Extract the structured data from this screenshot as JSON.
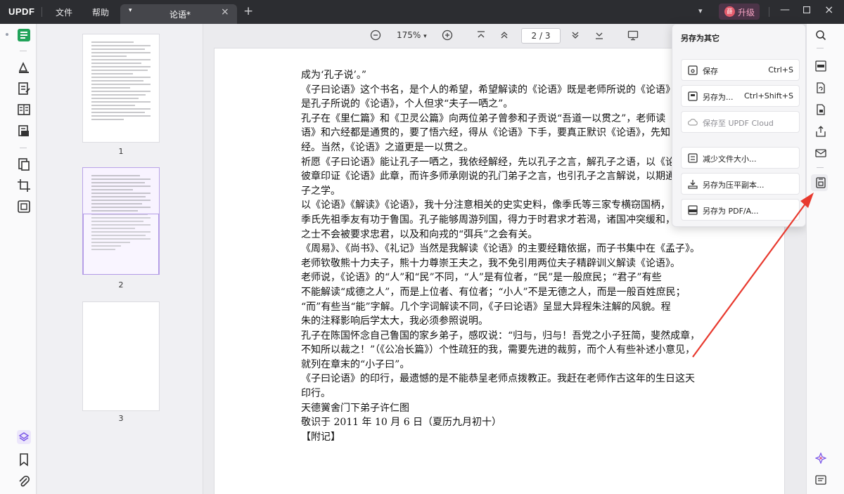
{
  "titlebar": {
    "logo": "UPDF",
    "menu": [
      "文件",
      "帮助"
    ],
    "tab_title": "论语*",
    "upgrade_avatar": "薛",
    "upgrade_label": "升级"
  },
  "toolbar": {
    "zoom": "175%",
    "page_current": "2",
    "page_total": "3"
  },
  "thumbnails": [
    {
      "number": "1"
    },
    {
      "number": "2"
    },
    {
      "number": "3"
    }
  ],
  "document": {
    "lines": [
      "成为‘孔子说’。”",
      "《子曰论语》这个书名，是个人的希望，希望解读的《论语》既是老师所说的《论语》",
      "是孔子所说的《论语》，个人但求“夫子一哂之”。",
      "孔子在《里仁篇》和《卫灵公篇》向两位弟子曾参和子贡说“吾道一以贯之”，老师读",
      "语》和六经都是通贯的，要了悟六经，得从《论语》下手，要真正默识《论语》，先知",
      "经。当然，《论语》之道更是一以贯之。",
      "祈愿《子曰论语》能让孔子一哂之，我依经解经，先以孔子之言，解孔子之语，以《论",
      "彼章印证《论语》此章，而许多师承刚说的孔门弟子之言，也引孔子之言解说，以期通",
      "子之学。",
      "以《论语》《解读》《论语》，我十分注意相关的史实史料，像季氏等三家专横窃国柄，",
      "季氏先祖季友有功于鲁国。孔子能够周游列国，得力于时君求才若渴，诸国冲突缓和，",
      "之士不会被要求忠君，以及和向戎的“弭兵”之会有关。",
      "《周易》、《尚书》、《礼记》当然是我解读《论语》的主要经籍依据，而子书集中在《孟子》。",
      "老师钦敬熊十力夫子，熊十力尊崇王夫之，我不免引用两位夫子精辟训义解读《论语》。",
      "老师说，《论语》的“人”和“民”不同，“人”是有位者，“民”是一般庶民；“君子”有些",
      "不能解读“成德之人”，而是上位者、有位者；“小人”不是无德之人，而是一般百姓庶民；",
      "“而”有些当“能”字解。几个字词解读不同，《子曰论语》呈显大异程朱注解的风貌。程",
      "朱的注释影响后学太大，我必须参照说明。",
      "孔子在陈国怀念自己鲁国的家乡弟子，感叹说：“归与，归与！吾党之小子狂简，斐然成章，",
      "不知所以裁之！”（《公冶长篇》）个性疏狂的我，需要先进的裁剪，而个人有些补述小意见，",
      "就列在章末的“小子曰”。",
      "《子曰论语》的印行，最遗憾的是不能恭呈老师点拨教正。我赶在老师作古这年的生日这天",
      "印行。",
      "天德黉舍门下弟子许仁图",
      "敬识于 2011 年 10 月 6 日（夏历九月初十）",
      "【附记】"
    ]
  },
  "save_popup": {
    "title": "另存为其它",
    "items": [
      {
        "label": "保存",
        "shortcut": "Ctrl+S",
        "enabled": true
      },
      {
        "label": "另存为...",
        "shortcut": "Ctrl+Shift+S",
        "enabled": true
      },
      {
        "label": "保存至 UPDF Cloud",
        "shortcut": "",
        "enabled": false
      },
      {
        "label": "减少文件大小...",
        "shortcut": "",
        "enabled": true
      },
      {
        "label": "另存为压平副本...",
        "shortcut": "",
        "enabled": true
      },
      {
        "label": "另存为 PDF/A...",
        "shortcut": "",
        "enabled": true
      }
    ]
  },
  "colors": {
    "accent": "#7b57e8",
    "titlebar": "#2c2d31",
    "annotation_arrow": "#e8392e"
  }
}
